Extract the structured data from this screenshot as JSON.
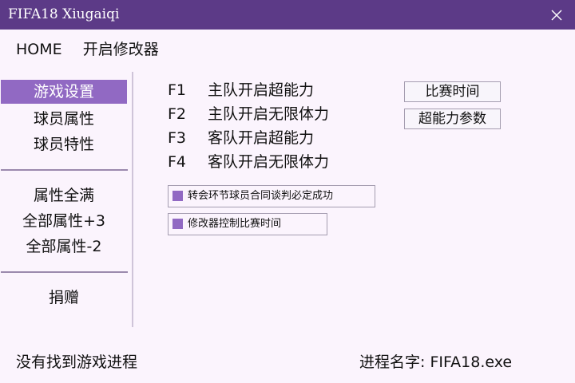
{
  "window": {
    "title": "FIFA18 Xiugaiqi"
  },
  "topnav": {
    "home": "HOME",
    "trainer": "开启修改器"
  },
  "sidebar": {
    "group1": [
      "游戏设置",
      "球员属性",
      "球员特性"
    ],
    "group2": [
      "属性全满",
      "全部属性+3",
      "全部属性-2"
    ],
    "group3": [
      "捐赠"
    ]
  },
  "hotkeys": [
    {
      "key": "F1",
      "label": "主队开启超能力"
    },
    {
      "key": "F2",
      "label": "主队开启无限体力"
    },
    {
      "key": "F3",
      "label": "客队开启超能力"
    },
    {
      "key": "F4",
      "label": "客队开启无限体力"
    }
  ],
  "buttons": {
    "match_time": "比赛时间",
    "super_params": "超能力参数"
  },
  "checkboxes": [
    {
      "label": "转会环节球员合同谈判必定成功"
    },
    {
      "label": "修改器控制比赛时间"
    }
  ],
  "status": {
    "process_status": "没有找到游戏进程",
    "process_name_label": "进程名字: FIFA18.exe"
  },
  "colors": {
    "titlebar": "#5c3a87",
    "accent": "#9169c3",
    "background": "#fbf4fd"
  }
}
